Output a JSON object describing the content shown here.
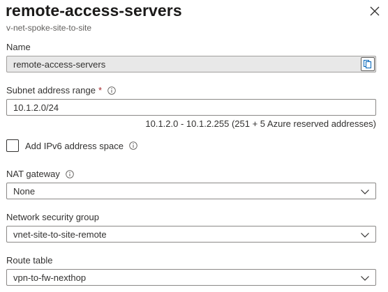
{
  "header": {
    "title": "remote-access-servers",
    "subtitle": "v-net-spoke-site-to-site",
    "close_icon": "close-icon"
  },
  "name_field": {
    "label": "Name",
    "value": "remote-access-servers",
    "copy_icon": "copy-icon"
  },
  "subnet_field": {
    "label": "Subnet address range",
    "required_marker": "*",
    "value": "10.1.2.0/24",
    "helper": "10.1.2.0 - 10.1.2.255 (251 + 5 Azure reserved addresses)",
    "info_icon": "info-icon"
  },
  "ipv6_checkbox": {
    "label": "Add IPv6 address space",
    "checked": false,
    "info_icon": "info-icon"
  },
  "nat_gateway": {
    "label": "NAT gateway",
    "value": "None",
    "info_icon": "info-icon"
  },
  "nsg": {
    "label": "Network security group",
    "value": "vnet-site-to-site-remote"
  },
  "route_table": {
    "label": "Route table",
    "value": "vpn-to-fw-nexthop"
  },
  "colors": {
    "required": "#a4262c",
    "border": "#8a8886",
    "readonly_bg": "#e8e8e8",
    "text": "#323130"
  }
}
